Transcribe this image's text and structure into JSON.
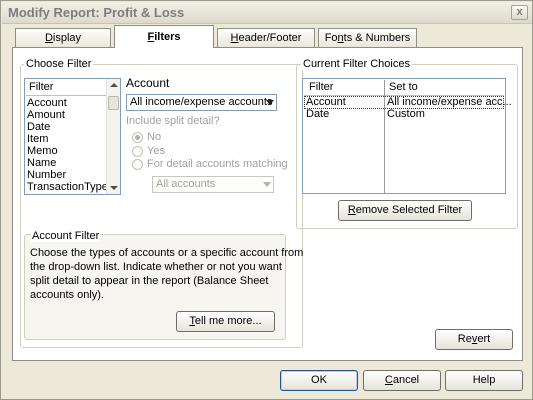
{
  "window": {
    "title": "Modify Report: Profit & Loss",
    "close_label": "x"
  },
  "tabs": [
    {
      "label": "Display",
      "mnemonic": "D",
      "rest": "isplay"
    },
    {
      "label": "Filters",
      "mnemonic": "F",
      "rest": "ilters"
    },
    {
      "label": "Header/Footer",
      "mnemonic": "H",
      "rest": "eader/Footer"
    },
    {
      "label": "Fonts & Numbers",
      "pre": "Fo",
      "mnemonic": "n",
      "rest": "ts & Numbers"
    }
  ],
  "choose_filter": {
    "title": "Choose Filter",
    "list_header": "Filter",
    "items": [
      "Account",
      "Amount",
      "Date",
      "Item",
      "Memo",
      "Name",
      "Number",
      "TransactionType"
    ]
  },
  "account": {
    "label": "Account",
    "selected": "All income/expense accounts",
    "split_detail_label": "Include split detail?",
    "radio_options": [
      {
        "label": "No",
        "checked": true
      },
      {
        "label": "Yes",
        "checked": false
      },
      {
        "label": "For detail accounts matching",
        "checked": false
      }
    ],
    "detail_accounts_value": "All accounts"
  },
  "account_filter": {
    "title": "Account Filter",
    "lines": [
      "Choose the types of accounts or a specific account from",
      "the drop-down list. Indicate whether or not you want",
      "split detail to appear in the report (Balance Sheet",
      "accounts only)."
    ],
    "tell_me_more": {
      "label": "Tell me more...",
      "mnemonic": "T",
      "rest": "ell me more..."
    }
  },
  "current_filters": {
    "title": "Current Filter Choices",
    "columns": [
      "Filter",
      "Set to"
    ],
    "rows": [
      {
        "filter": "Account",
        "set_to": "All income/expense acc..."
      },
      {
        "filter": "Date",
        "set_to": "Custom"
      }
    ],
    "remove_button": {
      "label": "Remove Selected Filter",
      "mnemonic": "R",
      "rest": "emove Selected Filter"
    }
  },
  "revert_button": {
    "label": "Revert",
    "pre": "Re",
    "mnemonic": "v",
    "rest": "ert"
  },
  "footer": {
    "ok": "OK",
    "cancel": {
      "label": "Cancel",
      "mnemonic": "C",
      "rest": "ancel"
    },
    "help": "Help"
  }
}
